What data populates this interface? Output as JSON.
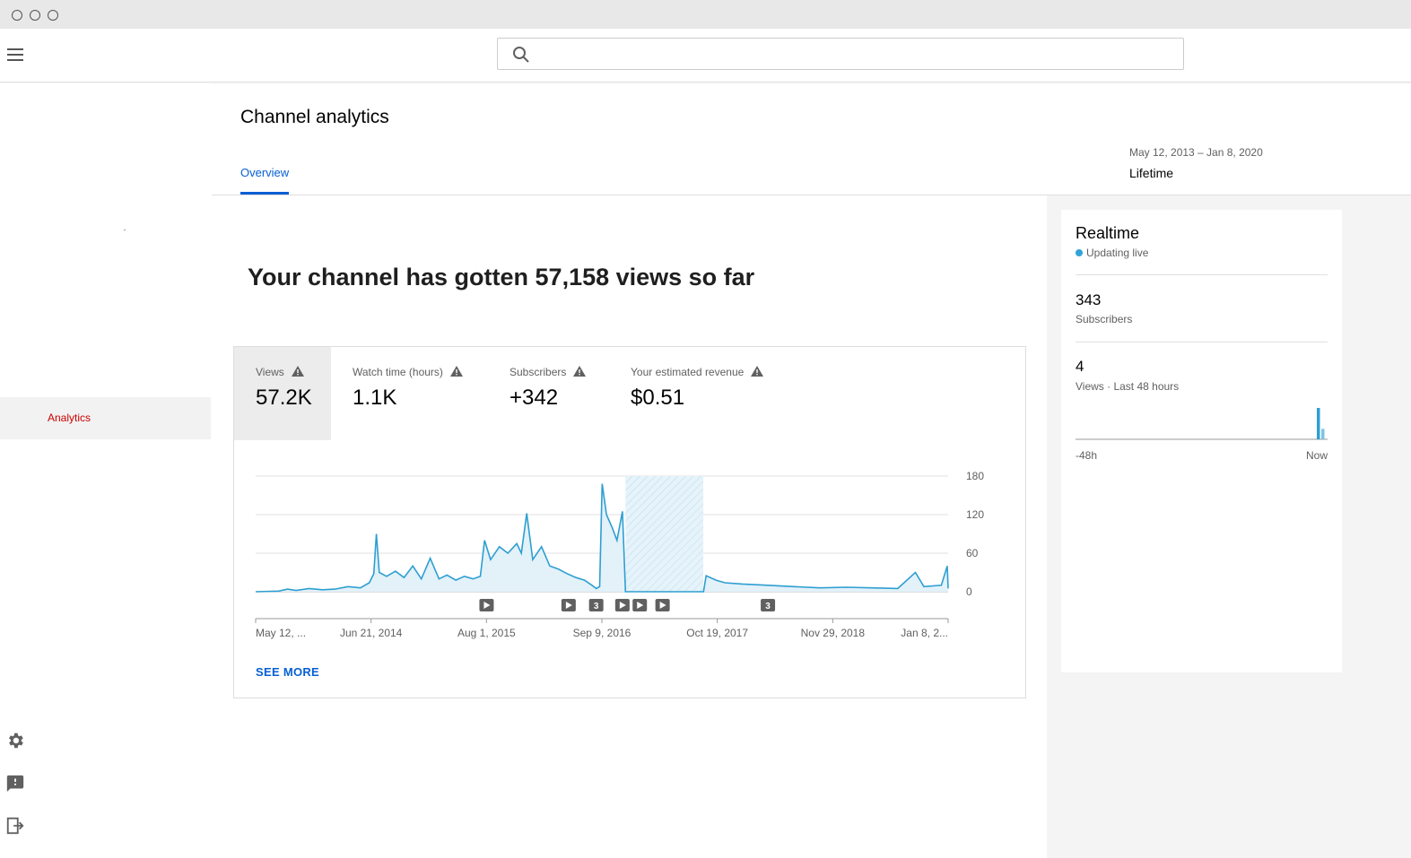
{
  "header": {
    "search_placeholder": ""
  },
  "sidebar": {
    "active_item": "Analytics"
  },
  "page": {
    "title": "Channel analytics",
    "tab_overview": "Overview",
    "date_range": "May 12, 2013 – Jan 8, 2020",
    "period": "Lifetime",
    "headline": "Your channel has gotten 57,158 views so far"
  },
  "metrics": [
    {
      "label": "Views",
      "value": "57.2K"
    },
    {
      "label": "Watch time (hours)",
      "value": "1.1K"
    },
    {
      "label": "Subscribers",
      "value": "+342"
    },
    {
      "label": "Your estimated revenue",
      "value": "$0.51"
    }
  ],
  "see_more": "SEE MORE",
  "chart_data": {
    "type": "line",
    "title": "",
    "xlabel": "",
    "ylabel": "",
    "x_ticks": [
      "May 12, ...",
      "Jun 21, 2014",
      "Aug 1, 2015",
      "Sep 9, 2016",
      "Oct 19, 2017",
      "Nov 29, 2018",
      "Jan 8, 2..."
    ],
    "y_ticks": [
      "180",
      "120",
      "60",
      "0"
    ],
    "ylim": [
      0,
      180
    ],
    "xlim": [
      "2013-05-12",
      "2020-01-08"
    ],
    "series": [
      {
        "color": "#2e9fd1",
        "points": [
          [
            "2013-05-12",
            0
          ],
          [
            "2013-08-01",
            1
          ],
          [
            "2013-09-01",
            4
          ],
          [
            "2013-10-01",
            2
          ],
          [
            "2013-11-15",
            5
          ],
          [
            "2014-01-01",
            3
          ],
          [
            "2014-02-15",
            4
          ],
          [
            "2014-04-01",
            8
          ],
          [
            "2014-05-15",
            6
          ],
          [
            "2014-06-15",
            14
          ],
          [
            "2014-07-01",
            28
          ],
          [
            "2014-07-10",
            90
          ],
          [
            "2014-07-20",
            30
          ],
          [
            "2014-08-15",
            24
          ],
          [
            "2014-09-15",
            32
          ],
          [
            "2014-10-15",
            22
          ],
          [
            "2014-11-15",
            40
          ],
          [
            "2014-12-15",
            20
          ],
          [
            "2015-01-15",
            52
          ],
          [
            "2015-02-15",
            20
          ],
          [
            "2015-03-15",
            26
          ],
          [
            "2015-04-15",
            18
          ],
          [
            "2015-05-15",
            24
          ],
          [
            "2015-06-15",
            20
          ],
          [
            "2015-07-10",
            24
          ],
          [
            "2015-07-25",
            80
          ],
          [
            "2015-08-15",
            50
          ],
          [
            "2015-09-15",
            70
          ],
          [
            "2015-10-15",
            60
          ],
          [
            "2015-11-15",
            75
          ],
          [
            "2015-12-01",
            60
          ],
          [
            "2015-12-20",
            122
          ],
          [
            "2016-01-10",
            50
          ],
          [
            "2016-02-10",
            70
          ],
          [
            "2016-03-10",
            40
          ],
          [
            "2016-04-10",
            35
          ],
          [
            "2016-05-10",
            28
          ],
          [
            "2016-06-10",
            22
          ],
          [
            "2016-07-10",
            18
          ],
          [
            "2016-08-05",
            10
          ],
          [
            "2016-08-20",
            5
          ],
          [
            "2016-09-01",
            8
          ],
          [
            "2016-09-10",
            168
          ],
          [
            "2016-09-25",
            120
          ],
          [
            "2016-10-15",
            100
          ],
          [
            "2016-11-01",
            80
          ],
          [
            "2016-11-20",
            125
          ],
          [
            "2016-12-01",
            0
          ],
          [
            "2017-09-01",
            0
          ],
          [
            "2017-09-10",
            25
          ],
          [
            "2017-10-15",
            18
          ],
          [
            "2017-11-15",
            14
          ],
          [
            "2018-01-15",
            12
          ],
          [
            "2018-04-15",
            10
          ],
          [
            "2018-07-15",
            8
          ],
          [
            "2018-10-15",
            6
          ],
          [
            "2019-01-15",
            7
          ],
          [
            "2019-04-15",
            6
          ],
          [
            "2019-07-15",
            5
          ],
          [
            "2019-09-15",
            30
          ],
          [
            "2019-10-15",
            8
          ],
          [
            "2019-12-15",
            10
          ],
          [
            "2020-01-05",
            40
          ],
          [
            "2020-01-08",
            5
          ]
        ]
      }
    ],
    "missing_data_range": [
      "2016-12-01",
      "2017-08-31"
    ],
    "markers": [
      {
        "date": "2015-08-01",
        "label": "▶"
      },
      {
        "date": "2016-05-15",
        "label": "▶"
      },
      {
        "date": "2016-08-20",
        "label": "3"
      },
      {
        "date": "2016-11-20",
        "label": "▶"
      },
      {
        "date": "2017-01-20",
        "label": "▶"
      },
      {
        "date": "2017-04-10",
        "label": "▶"
      },
      {
        "date": "2018-04-15",
        "label": "3"
      }
    ],
    "grid": true
  },
  "realtime": {
    "title": "Realtime",
    "status": "Updating live",
    "subscribers_value": "343",
    "subscribers_label": "Subscribers",
    "views_value": "4",
    "views_label": "Views · Last 48 hours",
    "axis_start": "-48h",
    "axis_end": "Now",
    "bars": [
      {
        "hour": -2,
        "value": 3
      },
      {
        "hour": -1,
        "value": 1
      }
    ]
  },
  "colors": {
    "accent": "#065fd4",
    "brand_red": "#cc0000",
    "series": "#2e9fd1"
  },
  "icons": [
    "menu-icon",
    "search-icon",
    "warning-icon",
    "gear-icon",
    "feedback-icon",
    "exit-icon",
    "play-icon"
  ]
}
